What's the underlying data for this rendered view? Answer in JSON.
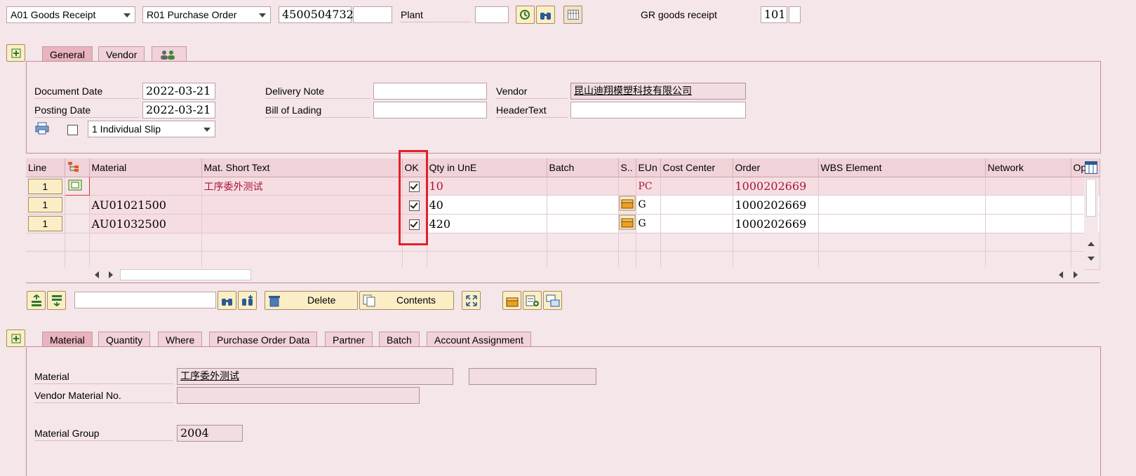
{
  "toolbar": {
    "action": "A01 Goods Receipt",
    "reference": "R01 Purchase Order",
    "po_number": "4500504732",
    "plant_label": "Plant",
    "gr_label": "GR goods receipt",
    "movement_type": "101"
  },
  "header_tabs": [
    "General",
    "Vendor"
  ],
  "general": {
    "document_date_label": "Document Date",
    "document_date": "2022-03-21",
    "posting_date_label": "Posting Date",
    "posting_date": "2022-03-21",
    "slip": "1 Individual Slip",
    "delivery_note_label": "Delivery Note",
    "bill_of_lading_label": "Bill of Lading",
    "vendor_label": "Vendor",
    "vendor": "昆山迪翔模塑科技有限公司",
    "header_text_label": "HeaderText"
  },
  "grid": {
    "columns": [
      "Line",
      "",
      "Material",
      "Mat. Short Text",
      "OK",
      "Qty in UnE",
      "Batch",
      "S..",
      "EUn",
      "Cost Center",
      "Order",
      "WBS Element",
      "Network",
      "Op"
    ],
    "rows": [
      {
        "line": "1",
        "material": "",
        "short_text": "工序委外测试",
        "ok": true,
        "qty": "10",
        "eun": "PC",
        "order": "1000202669"
      },
      {
        "line": "1",
        "material": "AU01021500",
        "short_text": "",
        "ok": true,
        "qty": "40",
        "eun": "G",
        "order": "1000202669"
      },
      {
        "line": "1",
        "material": "AU01032500",
        "short_text": "",
        "ok": true,
        "qty": "420",
        "eun": "G",
        "order": "1000202669"
      }
    ]
  },
  "actions": {
    "delete": "Delete",
    "contents": "Contents"
  },
  "detail_tabs": [
    "Material",
    "Quantity",
    "Where",
    "Purchase Order Data",
    "Partner",
    "Batch",
    "Account Assignment"
  ],
  "detail": {
    "material_label": "Material",
    "material": "工序委外测试",
    "vendor_material_label": "Vendor Material No.",
    "material_group_label": "Material Group",
    "material_group": "2004"
  },
  "colors": {
    "highlight": "#e0202a",
    "accent": "#a8153a"
  }
}
